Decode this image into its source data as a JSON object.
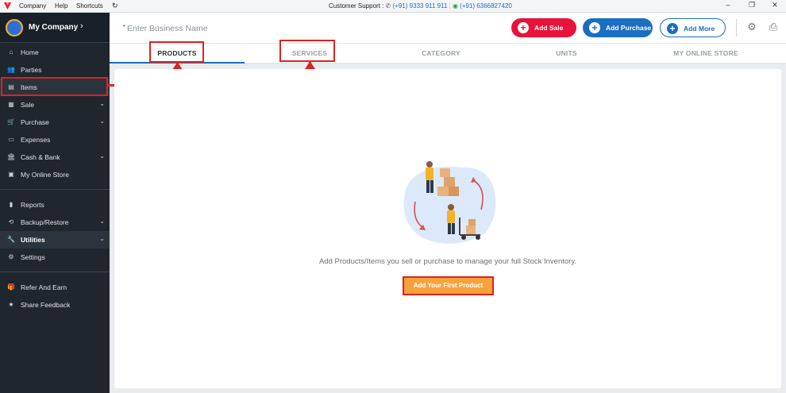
{
  "menubar": {
    "items": [
      "Company",
      "Help",
      "Shortcuts"
    ],
    "refresh_icon": "refresh-icon",
    "support_label": "Customer Support :",
    "phone": "(+91) 9333 911 911",
    "whatsapp": "(+91) 6366827420"
  },
  "sidebar": {
    "company_name": "My Company",
    "items": [
      {
        "label": "Home",
        "icon": "home-icon"
      },
      {
        "label": "Parties",
        "icon": "people-icon"
      },
      {
        "label": "Items",
        "icon": "items-icon"
      },
      {
        "label": "Sale",
        "icon": "sale-icon"
      },
      {
        "label": "Purchase",
        "icon": "cart-icon"
      },
      {
        "label": "Expenses",
        "icon": "expenses-icon"
      },
      {
        "label": "Cash & Bank",
        "icon": "bank-icon"
      },
      {
        "label": "My Online Store",
        "icon": "store-icon"
      },
      {
        "label": "Reports",
        "icon": "chart-icon"
      },
      {
        "label": "Backup/Restore",
        "icon": "backup-icon"
      },
      {
        "label": "Utilities",
        "icon": "wrench-icon"
      },
      {
        "label": "Settings",
        "icon": "gear-icon"
      },
      {
        "label": "Refer And Earn",
        "icon": "gift-icon"
      },
      {
        "label": "Share Feedback",
        "icon": "star-icon"
      }
    ]
  },
  "header": {
    "business_placeholder": "Enter Business Name",
    "add_sale": "Add Sale",
    "add_purchase": "Add Purchase",
    "add_more": "Add More"
  },
  "tabs": [
    "PRODUCTS",
    "SERVICES",
    "CATEGORY",
    "UNITS",
    "MY ONLINE STORE"
  ],
  "main": {
    "empty_message": "Add Products/Items you sell or purchase to manage your full Stock Inventory.",
    "cta": "Add Your First Product"
  },
  "colors": {
    "sidebar_bg": "#1f262e",
    "sale_red": "#e8133a",
    "primary_blue": "#1b6ec2",
    "cta_orange": "#f7a23b",
    "annotation_red": "#d9241f"
  }
}
